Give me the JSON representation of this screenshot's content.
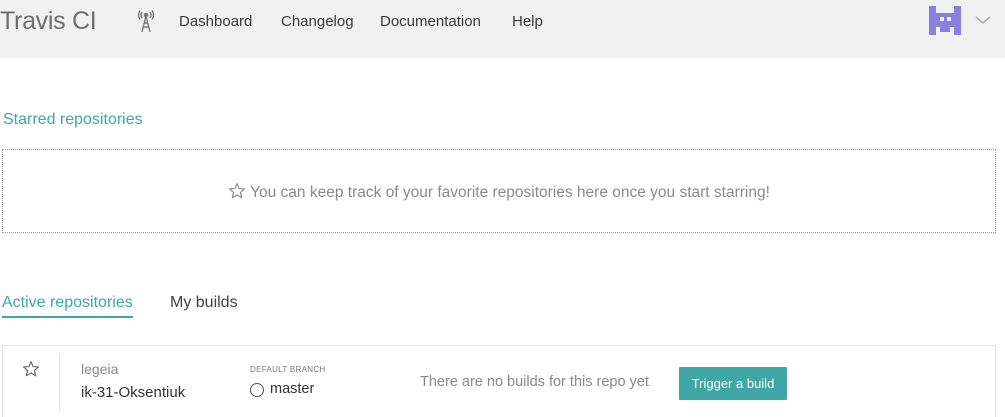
{
  "header": {
    "brand": "Travis CI",
    "nav": [
      "Dashboard",
      "Changelog",
      "Documentation",
      "Help"
    ]
  },
  "starred": {
    "title": "Starred repositories",
    "empty_message": "You can keep track of your favorite repositories here once you start starring!"
  },
  "tabs": {
    "active": "Active repositories",
    "builds": "My builds"
  },
  "repos": [
    {
      "owner": "legeia",
      "name": "ik-31-Oksentiuk",
      "branch_label": "DEFAULT BRANCH",
      "branch": "master",
      "status": "There are no builds for this repo yet",
      "action": "Trigger a build"
    }
  ],
  "colors": {
    "accent": "#3ea7a6",
    "avatar": "#8b7fe0",
    "header_bg": "#f1f1f1"
  },
  "icons": [
    "tower-icon",
    "avatar-icon",
    "chevron-down-icon",
    "star-icon",
    "branch-icon"
  ]
}
